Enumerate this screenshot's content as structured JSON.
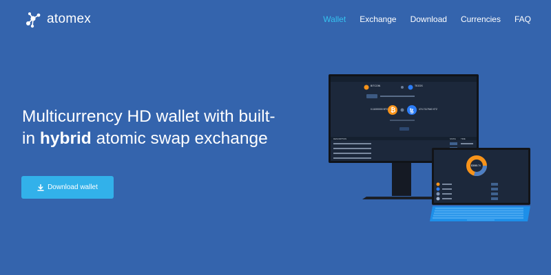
{
  "brand": {
    "name": "atomex",
    "logo_icon": "atom-nodes-icon"
  },
  "nav": {
    "items": [
      {
        "label": "Wallet",
        "active": true
      },
      {
        "label": "Exchange",
        "active": false
      },
      {
        "label": "Download",
        "active": false
      },
      {
        "label": "Currencies",
        "active": false
      },
      {
        "label": "FAQ",
        "active": false
      }
    ]
  },
  "hero": {
    "title_part1": "Multicurrency HD wallet with built-in ",
    "title_bold": "hybrid",
    "title_part2": " atomic swap exchange",
    "cta_label": "Download wallet",
    "cta_icon": "download-icon"
  },
  "colors": {
    "background": "#3464ad",
    "accent": "#35c2f0",
    "button": "#32b1ea",
    "bitcoin": "#f7931a",
    "tezos": "#2c7df7"
  },
  "app_preview": {
    "swap_from": "BITCOIN",
    "swap_to": "TEZOS",
    "send_amount": "0.11000000 BTC",
    "receive_amount": "474.7117540 XTZ",
    "table_header": "DESCRIPTION",
    "status_col": "STATE",
    "time_col": "TIME",
    "donut_value": "$3065.74"
  }
}
